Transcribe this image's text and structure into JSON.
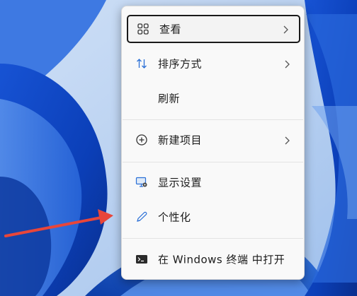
{
  "context_menu": {
    "items": [
      {
        "label": "查看",
        "icon": "view-grid-icon",
        "has_submenu": true,
        "focused": true
      },
      {
        "label": "排序方式",
        "icon": "sort-arrows-icon",
        "has_submenu": true
      },
      {
        "label": "刷新",
        "icon": "",
        "has_submenu": false
      },
      {
        "label": "新建项目",
        "icon": "plus-circle-icon",
        "has_submenu": true
      },
      {
        "label": "显示设置",
        "icon": "display-settings-icon",
        "has_submenu": false
      },
      {
        "label": "个性化",
        "icon": "pen-icon",
        "has_submenu": false
      },
      {
        "label": "在 Windows 终端 中打开",
        "icon": "terminal-icon",
        "has_submenu": false
      }
    ]
  },
  "colors": {
    "menu_background": "#f9f9f9",
    "focus_border": "#1a1a1a",
    "annotation_arrow": "#e8463a",
    "wallpaper_blue": "#1f5fd6"
  }
}
